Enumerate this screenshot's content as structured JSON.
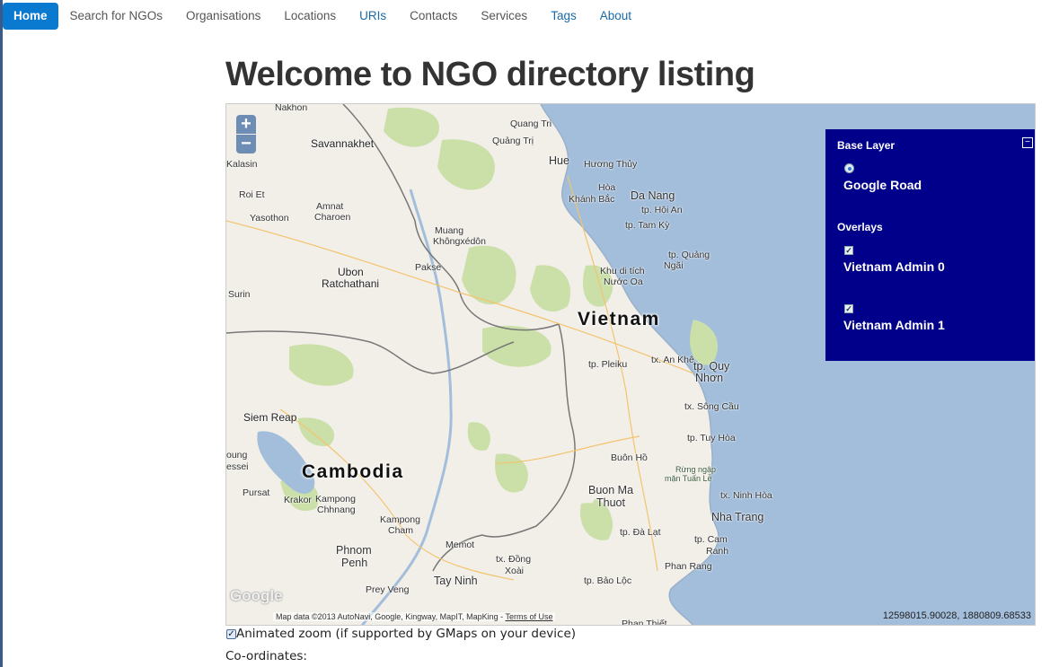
{
  "nav": {
    "items": [
      {
        "label": "Home"
      },
      {
        "label": "Search for NGOs"
      },
      {
        "label": "Organisations"
      },
      {
        "label": "Locations"
      },
      {
        "label": "URIs"
      },
      {
        "label": "Contacts"
      },
      {
        "label": "Services"
      },
      {
        "label": "Tags"
      },
      {
        "label": "About"
      }
    ]
  },
  "page": {
    "title": "Welcome to NGO directory listing"
  },
  "map": {
    "zoom_in": "+",
    "zoom_out": "−",
    "countries": {
      "vietnam": "Vietnam",
      "cambodia": "Cambodia"
    },
    "places": {
      "nakhon": "Nakhon",
      "quang_tri": "Quang Tri",
      "quang_tri2": "Quảng Trị",
      "savannakhet": "Savannakhet",
      "hue": "Hue",
      "huong_thuy": "Hương Thủy",
      "kalasin": "Kalasin",
      "hoa": "Hòa",
      "khanh_bac": "Khánh Bắc",
      "da_nang": "Da Nang",
      "roi_et": "Roi Et",
      "hoi_an": "tp. Hội An",
      "amnat1": "Amnat",
      "amnat2": "Charoen",
      "yasothon": "Yasothon",
      "tam_ky": "tp. Tam Kỳ",
      "muang1": "Muang",
      "muang2": "Khôngxédôn",
      "quang_ngai1": "tp. Quảng",
      "quang_ngai2": "Ngãi",
      "pakse": "Pakse",
      "khu1": "Khu di tích",
      "khu2": "Nước Oa",
      "ubon1": "Ubon",
      "ubon2": "Ratchathani",
      "surin": "Surin",
      "an_khe": "tx. An Khê",
      "pleiku": "tp. Pleiku",
      "quy_nhon1": "tp. Quy",
      "quy_nhon2": "Nhơn",
      "siem_reap": "Siem Reap",
      "song_cau": "tx. Sông Cầu",
      "tuy_hoa": "tp. Tuy Hòa",
      "buon_ho": "Buôn Hồ",
      "moung1": "oung",
      "moung2": "essei",
      "rung1": "Rừng ngập",
      "rung2": "mặn Tuấn Lễ",
      "pursat": "Pursat",
      "buon_ma1": "Buon Ma",
      "buon_ma2": "Thuot",
      "ninh_hoa": "tx. Ninh Hòa",
      "krakor": "Krakor",
      "kampong_chhnang1": "Kampong",
      "kampong_chhnang2": "Chhnang",
      "nha_trang": "Nha Trang",
      "kampong_cham1": "Kampong",
      "kampong_cham2": "Cham",
      "da_lat": "tp. Đà Lạt",
      "memot": "Memot",
      "cam_ranh1": "tp. Cam",
      "cam_ranh2": "Ranh",
      "phnom_penh1": "Phnom",
      "phnom_penh2": "Penh",
      "dong_xoai1": "tx. Đồng",
      "dong_xoai2": "Xoài",
      "phan_rang": "Phan Rang",
      "prey_veng": "Prey Veng",
      "tay_ninh": "Tay Ninh",
      "bao_loc": "tp. Bảo Lộc",
      "phan_thiet": "Phan Thiết"
    },
    "google_logo": "Google",
    "attribution": "Map data ©2013 AutoNavi, Google, Kingway, MapIT, MapKing -",
    "terms": "Terms of Use",
    "mouse_position": "12598015.90028, 1880809.68533",
    "layer_switcher": {
      "minimize": "−",
      "base_layer_title": "Base Layer",
      "base_layers": [
        {
          "label": "Google Road",
          "selected": true
        }
      ],
      "overlays_title": "Overlays",
      "overlays": [
        {
          "label": "Vietnam Admin 0",
          "checked": true
        },
        {
          "label": "Vietnam Admin 1",
          "checked": true
        }
      ]
    }
  },
  "options": {
    "animated_zoom_label": "Animated zoom (if supported by GMaps on your device)",
    "animated_zoom_checked": true
  },
  "coordinates_label": "Co-ordinates:",
  "colors": {
    "nav_active": "#0a7ad0",
    "link": "#1a6aa8",
    "layer_switcher_bg": "#00008b",
    "sea": "#a3bedb",
    "land": "#f2efe9",
    "forest": "#cbe0a8"
  }
}
